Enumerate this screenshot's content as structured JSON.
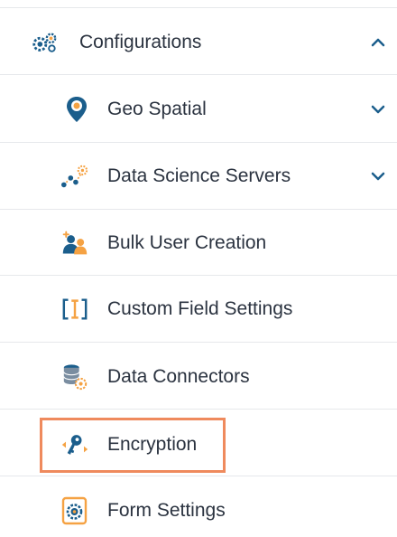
{
  "menu": {
    "items": [
      {
        "label": "Configurations",
        "icon": "gears-icon",
        "expanded": true
      },
      {
        "label": "Geo Spatial",
        "icon": "map-pin-icon",
        "expanded": false
      },
      {
        "label": "Data Science Servers",
        "icon": "data-science-icon",
        "expanded": false
      },
      {
        "label": "Bulk User Creation",
        "icon": "users-add-icon"
      },
      {
        "label": "Custom Field Settings",
        "icon": "custom-field-icon"
      },
      {
        "label": "Data Connectors",
        "icon": "database-gear-icon"
      },
      {
        "label": "Encryption",
        "icon": "key-icon",
        "highlighted": true
      },
      {
        "label": "Form Settings",
        "icon": "form-gear-icon"
      }
    ]
  },
  "colors": {
    "text": "#2b3340",
    "icon_blue": "#1b5e8c",
    "icon_orange": "#f5a243",
    "highlight": "#ef8a5d",
    "divider": "#e6e8eb"
  }
}
